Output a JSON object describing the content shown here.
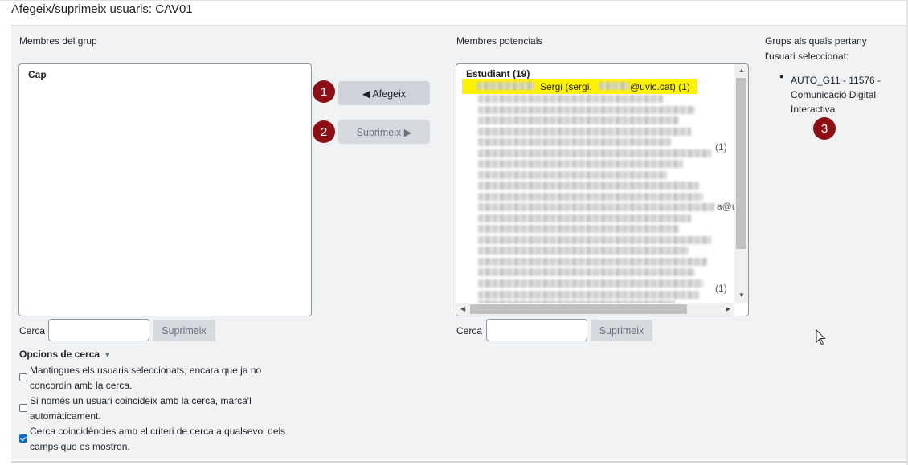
{
  "page": {
    "title": "Afegeix/suprimeix usuaris: CAV01"
  },
  "current_members": {
    "label": "Membres del grup",
    "options": [
      "Cap"
    ],
    "search_label": "Cerca",
    "search_value": "",
    "clear_button": "Suprimeix"
  },
  "actions": {
    "add_button": "◀ Afegeix",
    "remove_button": "Suprimeix ▶",
    "add_badge": "1",
    "remove_badge": "2"
  },
  "potential_members": {
    "label": "Membres potencials",
    "group_header": "Estudiant (19)",
    "selected_option": "Sergi (sergi.",
    "selected_option_email": "@uvic.cat) (1)",
    "visible_fragments": [
      "(1)",
      "a@uv",
      "(1)"
    ],
    "search_label": "Cerca",
    "search_value": "",
    "clear_button": "Suprimeix"
  },
  "groups_info": {
    "label_line1": "Grups als quals pertany",
    "label_line2": "l'usuari seleccionat:",
    "items": [
      "AUTO_G11 - 11576 -",
      "Comunicació Digital",
      "Interactiva"
    ],
    "badge": "3"
  },
  "search_options": {
    "title": "Opcions de cerca",
    "options": [
      {
        "line1": "Mantingues els usuaris seleccionats, encara que ja no",
        "line2": "concordin amb la cerca.",
        "checked": false
      },
      {
        "line1": "Si només un usuari coincideix amb la cerca, marca'l",
        "line2": "automàticament.",
        "checked": false
      },
      {
        "line1": "Cerca coincidències amb el criteri de cerca a qualsevol dels",
        "line2": "camps que es mostren.",
        "checked": true
      }
    ]
  },
  "colors": {
    "badge": "#8b0f14",
    "highlight": "#fff200",
    "checkbox_checked": "#0f6cbf"
  }
}
